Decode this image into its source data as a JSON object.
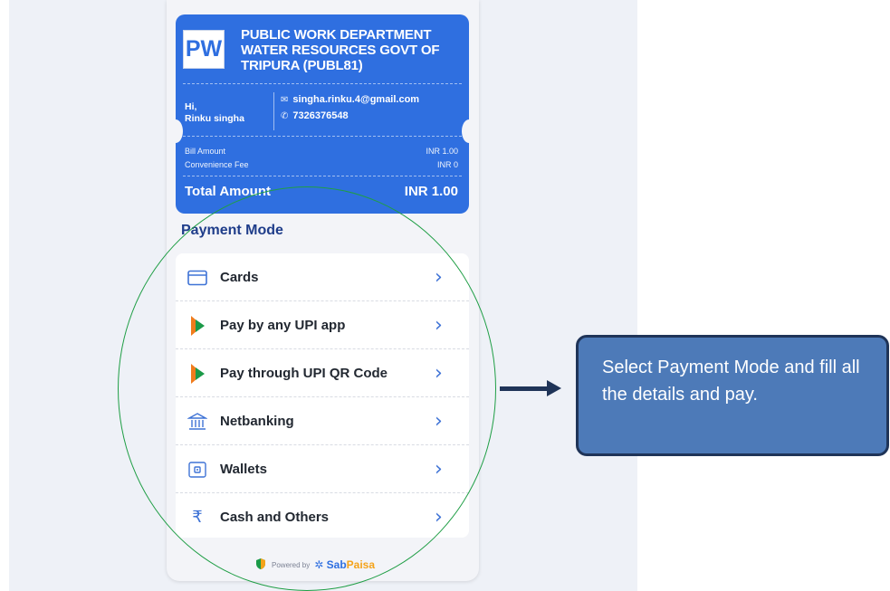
{
  "header": {
    "logo_text": "PW",
    "department": "PUBLIC WORK DEPARTMENT WATER RESOURCES GOVT OF TRIPURA (PUBL81)",
    "greeting": "Hi,",
    "user_name": "Rinku singha",
    "email": "singha.rinku.4@gmail.com",
    "phone": "7326376548",
    "email_icon": "mail-icon",
    "phone_icon": "phone-icon"
  },
  "fees": {
    "bill_label": "Bill Amount",
    "bill_value": "INR 1.00",
    "fee_label": "Convenience Fee",
    "fee_value": "INR 0",
    "total_label": "Total Amount",
    "total_value": "INR 1.00"
  },
  "payment": {
    "title": "Payment Mode",
    "items": [
      {
        "label": "Cards",
        "icon": "card-icon"
      },
      {
        "label": "Pay by any UPI app",
        "icon": "upi-icon"
      },
      {
        "label": "Pay through UPI QR Code",
        "icon": "upi-icon"
      },
      {
        "label": "Netbanking",
        "icon": "bank-icon"
      },
      {
        "label": "Wallets",
        "icon": "wallet-icon"
      },
      {
        "label": "Cash and Others",
        "icon": "rupee-icon"
      }
    ]
  },
  "footer": {
    "powered_by": "Powered by",
    "brand_a": "Sab",
    "brand_b": "Paisa"
  },
  "callout": {
    "text": "Select Payment Mode and fill all the details and pay."
  },
  "colors": {
    "primary": "#2f6fe0",
    "highlight_circle": "#1f9e45",
    "callout_bg": "#4d7ab8",
    "arrow": "#1f3458"
  }
}
